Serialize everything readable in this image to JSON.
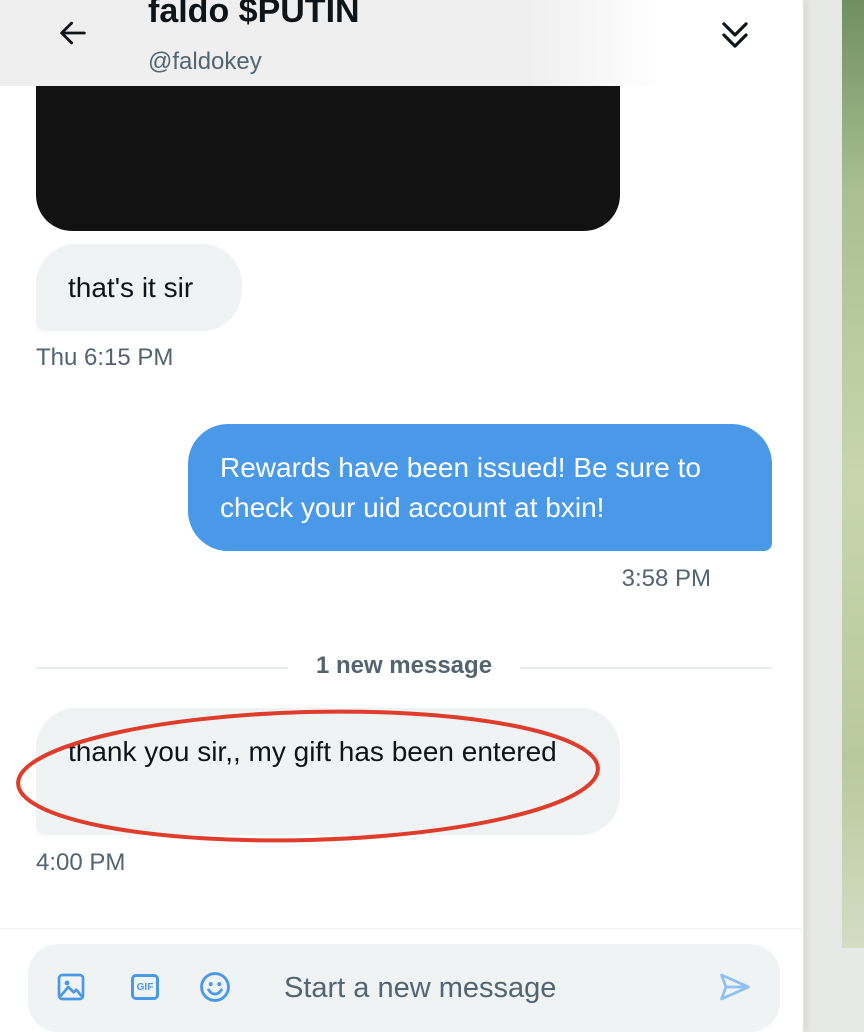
{
  "conversation": {
    "name": "faldo $PUTIN",
    "handle": "@faldokey"
  },
  "messages": [
    {
      "direction": "incoming",
      "text": "that's it sir",
      "timestamp": "Thu 6:15 PM"
    },
    {
      "direction": "outgoing",
      "text": "Rewards have been issued! Be sure to check your uid account at bxin!",
      "timestamp": "3:58 PM"
    },
    {
      "direction": "incoming",
      "text": "thank you sir,, my gift has been entered",
      "timestamp": "4:00 PM"
    }
  ],
  "new_message_divider": "1 new message",
  "composer": {
    "placeholder": "Start a new message"
  },
  "icons": {
    "back": "arrow-left-icon",
    "collapse": "double-chevron-down-icon",
    "image": "image-icon",
    "gif": "gif-icon",
    "emoji": "emoji-icon",
    "send": "send-icon"
  },
  "colors": {
    "accent": "#4a99e9",
    "incoming_bubble": "#eff3f4",
    "annotation": "#e03c2c"
  }
}
